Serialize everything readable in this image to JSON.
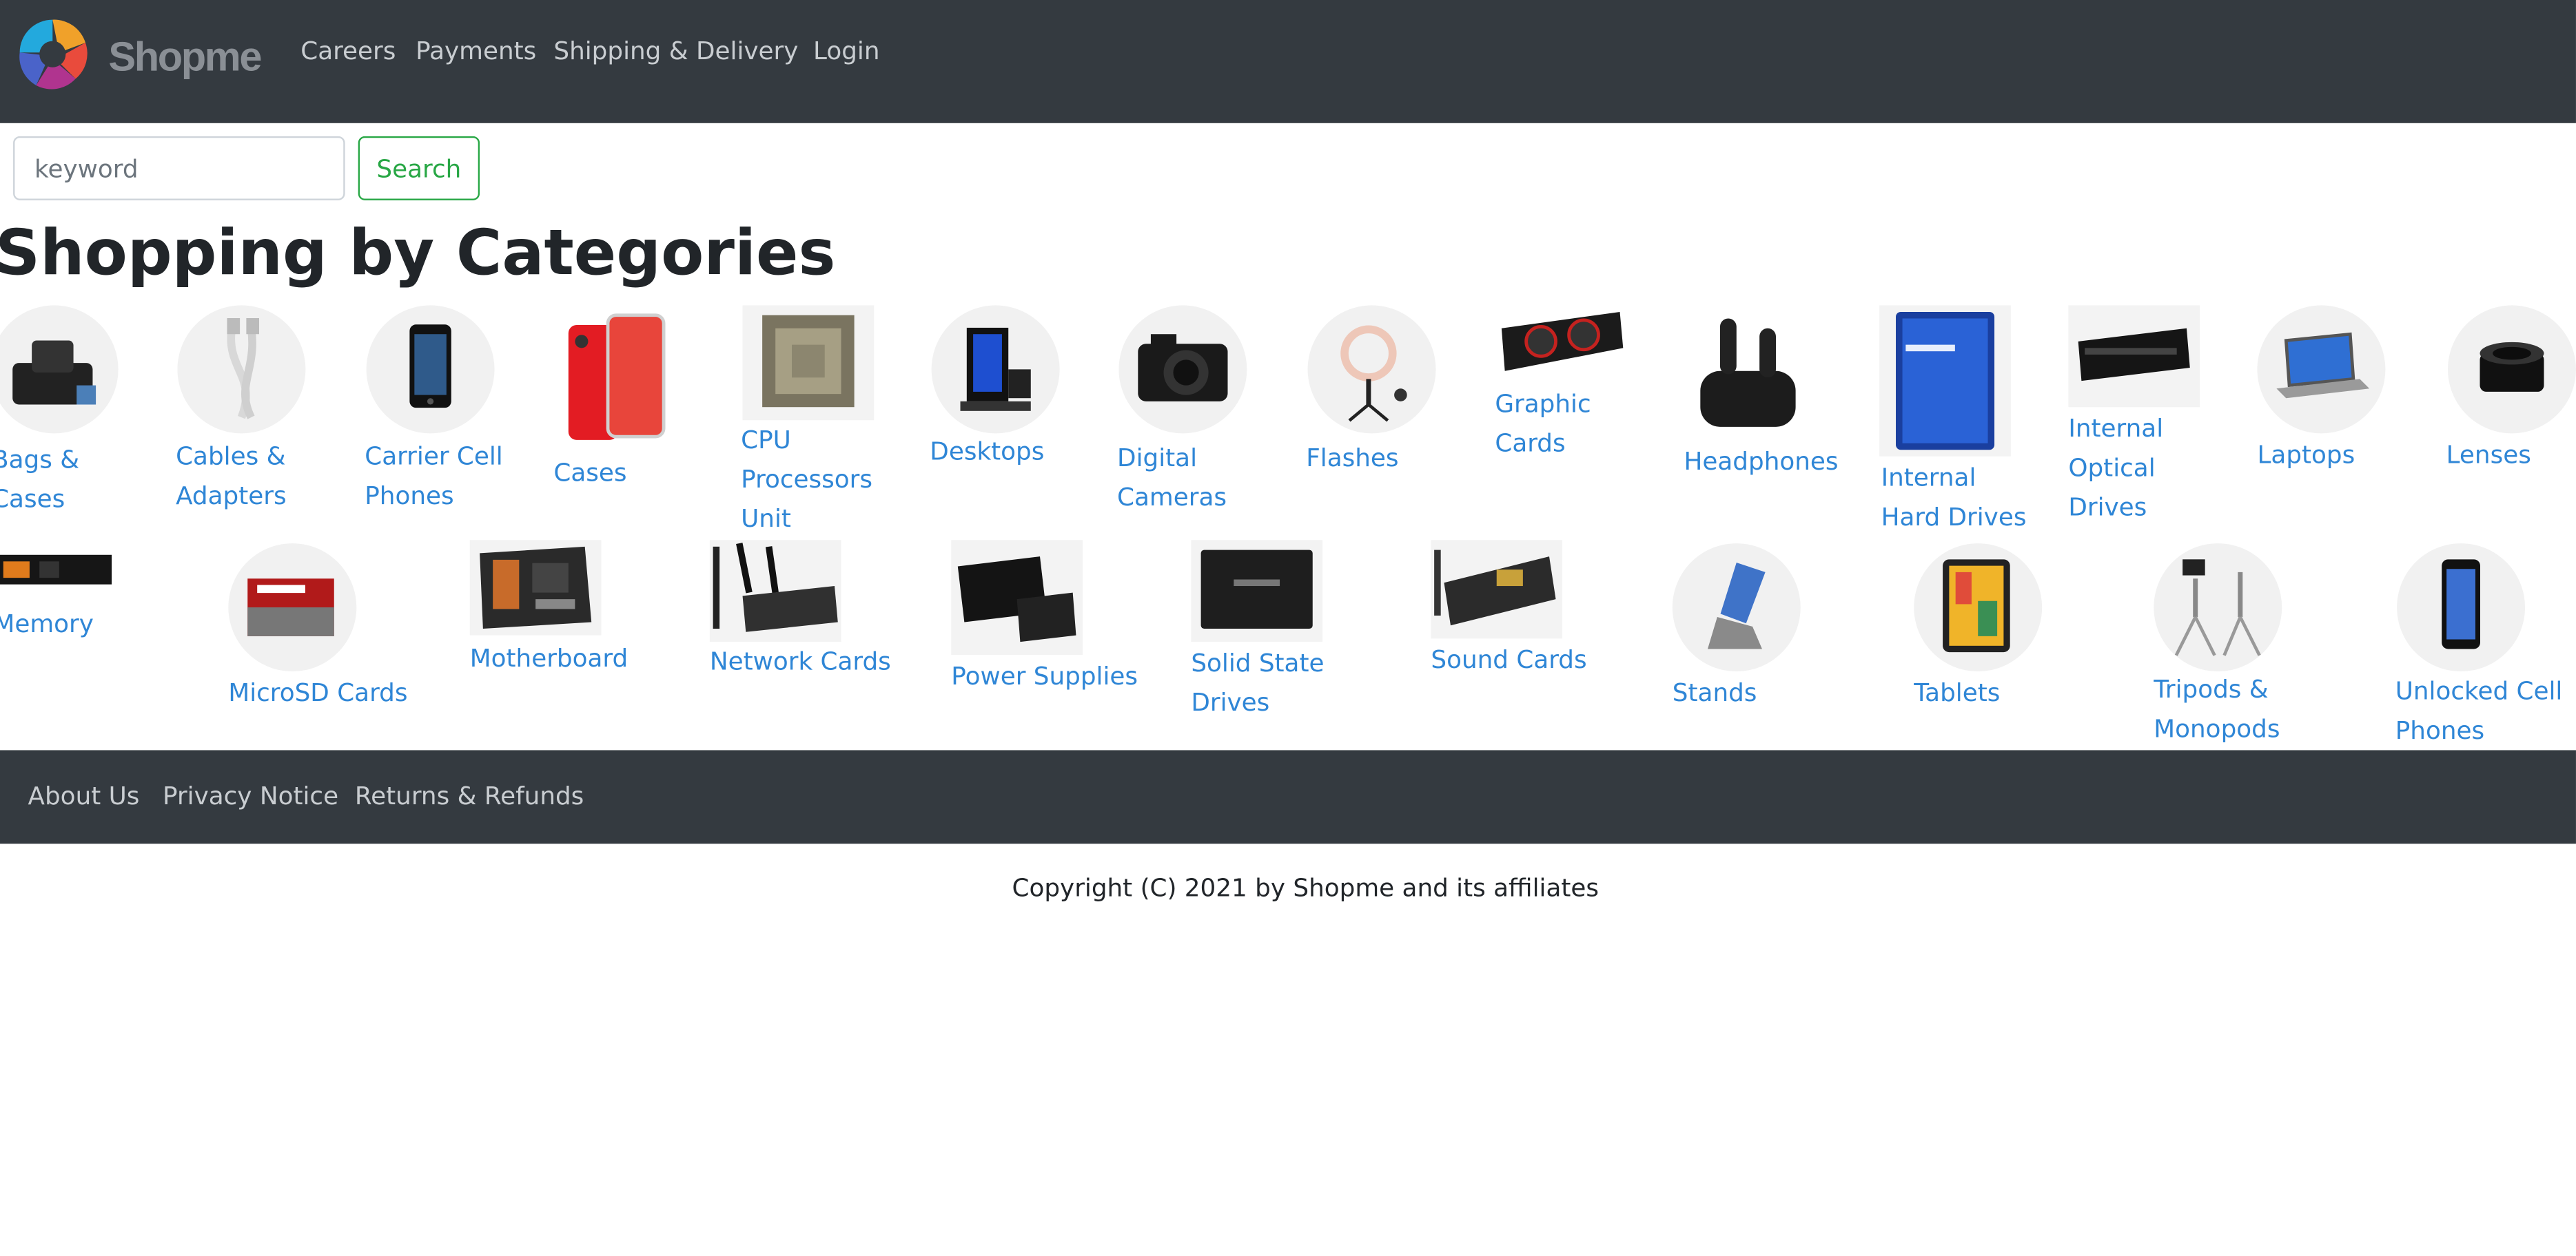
{
  "header": {
    "brand": "Shopme",
    "nav": [
      "Careers",
      "Payments",
      "Shipping & Delivery",
      "Login"
    ]
  },
  "search": {
    "placeholder": "keyword",
    "button_label": "Search"
  },
  "main": {
    "title": "Shopping by Categories",
    "categories": [
      {
        "lines": [
          "Bags &",
          "Cases"
        ],
        "icon": "bag-icon"
      },
      {
        "lines": [
          "Cables &",
          "Adapters"
        ],
        "icon": "cable-icon"
      },
      {
        "lines": [
          "Carrier Cell",
          "Phones"
        ],
        "icon": "phone-icon"
      },
      {
        "lines": [
          "Cases"
        ],
        "icon": "phone-case-icon"
      },
      {
        "lines": [
          "CPU",
          "Processors",
          "Unit"
        ],
        "icon": "cpu-icon"
      },
      {
        "lines": [
          "Desktops"
        ],
        "icon": "desktop-icon"
      },
      {
        "lines": [
          "Digital",
          "Cameras"
        ],
        "icon": "camera-icon"
      },
      {
        "lines": [
          "Flashes"
        ],
        "icon": "ring-light-icon"
      },
      {
        "lines": [
          "Graphic",
          "Cards"
        ],
        "icon": "gpu-icon"
      },
      {
        "lines": [
          "Headphones"
        ],
        "icon": "earbuds-icon"
      },
      {
        "lines": [
          "Internal",
          "Hard Drives"
        ],
        "icon": "hard-drive-icon"
      },
      {
        "lines": [
          "Internal",
          "Optical",
          "Drives"
        ],
        "icon": "optical-drive-icon"
      },
      {
        "lines": [
          "Laptops"
        ],
        "icon": "laptop-icon"
      },
      {
        "lines": [
          "Lenses"
        ],
        "icon": "lens-icon"
      },
      {
        "lines": [
          "Memory"
        ],
        "icon": "memory-icon"
      },
      {
        "lines": [
          "MicroSD Cards"
        ],
        "icon": "sd-card-icon"
      },
      {
        "lines": [
          "Motherboard"
        ],
        "icon": "motherboard-icon"
      },
      {
        "lines": [
          "Network Cards"
        ],
        "icon": "network-card-icon"
      },
      {
        "lines": [
          "Power Supplies"
        ],
        "icon": "power-supply-icon"
      },
      {
        "lines": [
          "Solid State",
          "Drives"
        ],
        "icon": "ssd-icon"
      },
      {
        "lines": [
          "Sound Cards"
        ],
        "icon": "sound-card-icon"
      },
      {
        "lines": [
          "Stands"
        ],
        "icon": "stand-icon"
      },
      {
        "lines": [
          "Tablets"
        ],
        "icon": "tablet-icon"
      },
      {
        "lines": [
          "Tripods &",
          "Monopods"
        ],
        "icon": "tripod-icon"
      },
      {
        "lines": [
          "Unlocked Cell",
          "Phones"
        ],
        "icon": "smartphone-icon"
      }
    ]
  },
  "footer": {
    "links": [
      "About Us",
      "Privacy Notice",
      "Returns & Refunds"
    ],
    "copyright": "Copyright (C) 2021 by Shopme and its affiliates"
  },
  "colors": {
    "navbar": "#343a40",
    "link": "#2f86d6",
    "search_button": "#28a745"
  }
}
